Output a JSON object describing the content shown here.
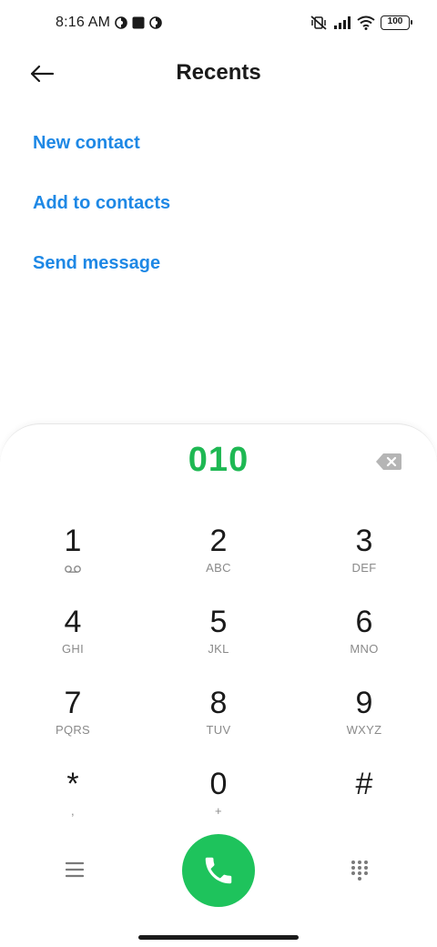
{
  "status_bar": {
    "time": "8:16 AM",
    "battery": "100",
    "icons": [
      "theme-icon",
      "square-icon",
      "theme-icon",
      "mute-vibrate-icon",
      "signal-icon",
      "wifi-icon",
      "battery-icon"
    ]
  },
  "header": {
    "title": "Recents",
    "back_icon": "arrow-left-icon"
  },
  "actions": {
    "new_contact": "New contact",
    "add_to_contacts": "Add to contacts",
    "send_message": "Send message"
  },
  "dialer": {
    "number": "010",
    "backspace_icon": "backspace-icon",
    "keys": [
      {
        "digit": "1",
        "sub": ""
      },
      {
        "digit": "2",
        "sub": "ABC"
      },
      {
        "digit": "3",
        "sub": "DEF"
      },
      {
        "digit": "4",
        "sub": "GHI"
      },
      {
        "digit": "5",
        "sub": "JKL"
      },
      {
        "digit": "6",
        "sub": "MNO"
      },
      {
        "digit": "7",
        "sub": "PQRS"
      },
      {
        "digit": "8",
        "sub": "TUV"
      },
      {
        "digit": "9",
        "sub": "WXYZ"
      },
      {
        "digit": "*",
        "sub": ","
      },
      {
        "digit": "0",
        "sub": "+"
      },
      {
        "digit": "#",
        "sub": ""
      }
    ],
    "menu_icon": "menu-icon",
    "call_icon": "phone-icon",
    "grid_icon": "keypad-grid-icon",
    "colors": {
      "number": "#1eb853",
      "call_button": "#1ec35c",
      "link": "#1e88e5"
    }
  }
}
